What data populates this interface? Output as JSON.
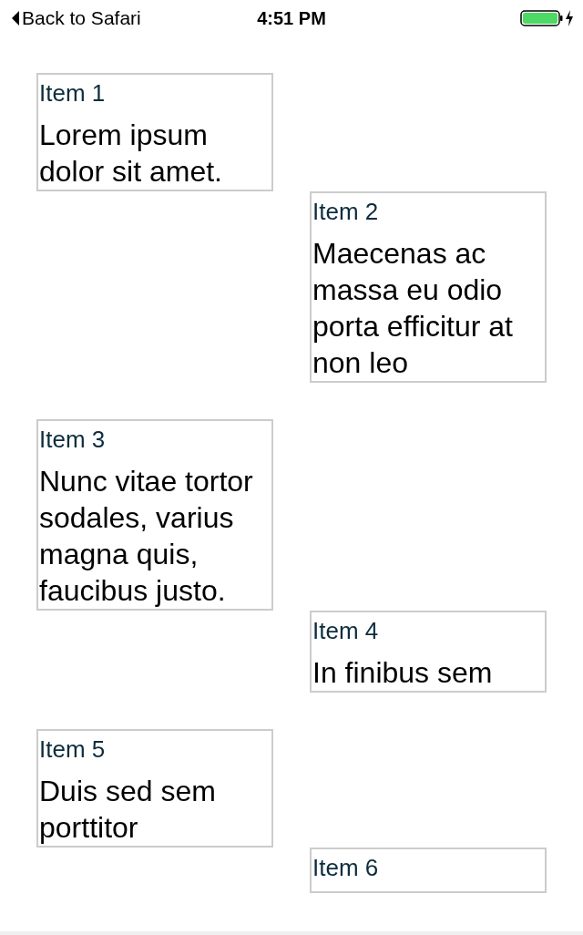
{
  "status_bar": {
    "back_label": "Back to Safari",
    "time": "4:51 PM"
  },
  "items": [
    {
      "title": "Item 1",
      "text": "Lorem ipsum dolor sit amet."
    },
    {
      "title": "Item 2",
      "text": "Maecenas ac massa eu odio porta efficitur at non leo"
    },
    {
      "title": "Item 3",
      "text": "Nunc vitae tortor sodales, varius magna quis, faucibus justo."
    },
    {
      "title": "Item 4",
      "text": "In finibus sem"
    },
    {
      "title": "Item 5",
      "text": "Duis sed sem porttitor"
    },
    {
      "title": "Item 6"
    }
  ]
}
